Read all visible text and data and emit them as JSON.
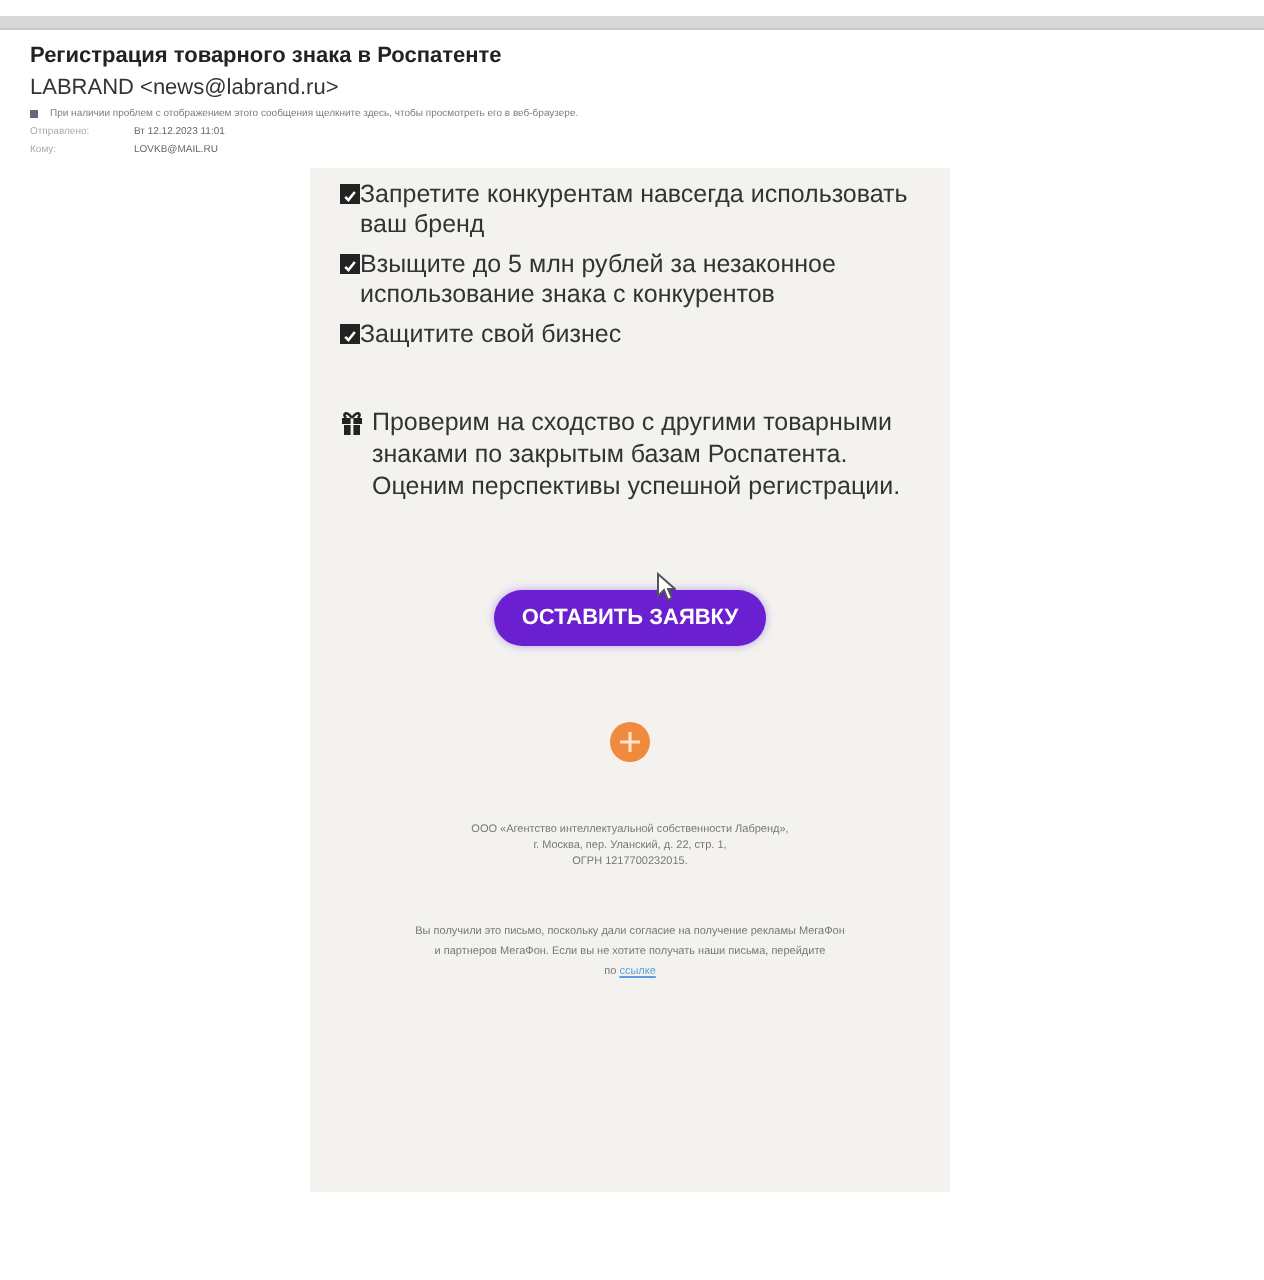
{
  "message": {
    "subject": "Регистрация товарного знака в Роспатенте",
    "sender": "LABRAND <news@labrand.ru>",
    "info_bar": "При наличии проблем с отображением этого сообщения щелкните здесь, чтобы просмотреть его в веб-браузере.",
    "fields": [
      {
        "label": "Отправлено:",
        "value": "Вт 12.12.2023 11:01"
      },
      {
        "label": "Кому:",
        "value": "LOVKB@MAIL.RU"
      }
    ]
  },
  "body": {
    "benefits": [
      {
        "text": "Запретите конкурентам навсегда использовать ваш бренд",
        "checked": true
      },
      {
        "text": "Взыщите до 5 млн рублей за незаконное использование знака с конкурентов",
        "checked": true
      },
      {
        "text": "Защитите свой бизнес",
        "checked": true
      }
    ],
    "offer": "Проверим на сходство с другими товарными знаками по закрытым базам Роспатента. Оценим перспективы успешной регистрации.",
    "button": "ОСТАВИТЬ ЗАЯВКУ",
    "company": [
      "ООО «Агентство интеллектуальной собственности Лабренд»,",
      "г. Москва, пер. Уланский, д. 22, стр. 1,",
      "ОГРН 1217700232015."
    ],
    "notice": [
      "Вы получили это письмо, поскольку дали согласие на получение рекламы МегаФон",
      "и партнеров МегаФон. Если вы не хотите получать наши письма, перейдите"
    ],
    "notice_link_prefix": "по",
    "notice_link": "ссылке"
  }
}
